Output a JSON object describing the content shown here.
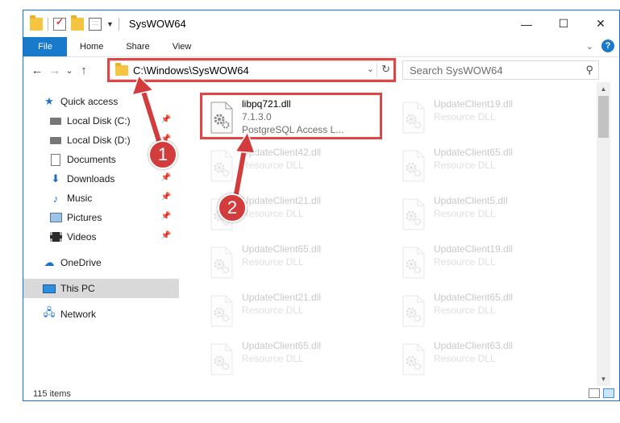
{
  "window": {
    "title": "SysWOW64",
    "controls": {
      "minimize": "—",
      "maximize": "☐",
      "close": "✕"
    }
  },
  "ribbon": {
    "tabs": [
      "File",
      "Home",
      "Share",
      "View"
    ],
    "help": "?"
  },
  "nav": {
    "back": "←",
    "forward": "→",
    "recent": "⌄",
    "up": "↑",
    "address": "C:\\Windows\\SysWOW64",
    "search_placeholder": "Search SysWOW64",
    "refresh": "↻",
    "dropdown": "⌄",
    "search_icon": "⚲"
  },
  "sidebar": {
    "items": [
      {
        "label": "Quick access",
        "icon": "star-icon"
      },
      {
        "label": "Local Disk (C:)",
        "icon": "drive-icon",
        "pinned": true
      },
      {
        "label": "Local Disk (D:)",
        "icon": "drive-icon",
        "pinned": true
      },
      {
        "label": "Documents",
        "icon": "documents-icon",
        "pinned": true
      },
      {
        "label": "Downloads",
        "icon": "download-icon",
        "pinned": true
      },
      {
        "label": "Music",
        "icon": "music-icon",
        "pinned": true
      },
      {
        "label": "Pictures",
        "icon": "pictures-icon",
        "pinned": true
      },
      {
        "label": "Videos",
        "icon": "videos-icon",
        "pinned": true
      },
      {
        "label": "OneDrive",
        "icon": "cloud-icon"
      },
      {
        "label": "This PC",
        "icon": "computer-icon",
        "selected": true
      },
      {
        "label": "Network",
        "icon": "network-icon"
      }
    ]
  },
  "files": [
    {
      "name": "libpq721.dll",
      "line2": "7.1.3.0",
      "line3": "PostgreSQL Access L...",
      "faded": false
    },
    {
      "name": "UpdateClient19.dll",
      "line2": "Resource DLL",
      "faded": true
    },
    {
      "name": "UpdateClient42.dll",
      "line2": "Resource DLL",
      "faded": true
    },
    {
      "name": "UpdateClient65.dll",
      "line2": "Resource DLL",
      "faded": true
    },
    {
      "name": "UpdateClient21.dll",
      "line2": "Resource DLL",
      "faded": true
    },
    {
      "name": "UpdateClient5.dll",
      "line2": "Resource DLL",
      "faded": true
    },
    {
      "name": "UpdateClient65.dll",
      "line2": "Resource DLL",
      "faded": true
    },
    {
      "name": "UpdateClient19.dll",
      "line2": "Resource DLL",
      "faded": true
    },
    {
      "name": "UpdateClient21.dll",
      "line2": "Resource DLL",
      "faded": true
    },
    {
      "name": "UpdateClient65.dll",
      "line2": "Resource DLL",
      "faded": true
    },
    {
      "name": "UpdateClient65.dll",
      "line2": "Resource DLL",
      "faded": true
    },
    {
      "name": "UpdateClient63.dll",
      "line2": "Resource DLL",
      "faded": true
    }
  ],
  "status": {
    "count": "115 items"
  },
  "annotations": {
    "step1": "1",
    "step2": "2",
    "highlight_color": "#e04646",
    "callout_color": "#d23c3c"
  },
  "colors": {
    "accent": "#1979ca"
  }
}
